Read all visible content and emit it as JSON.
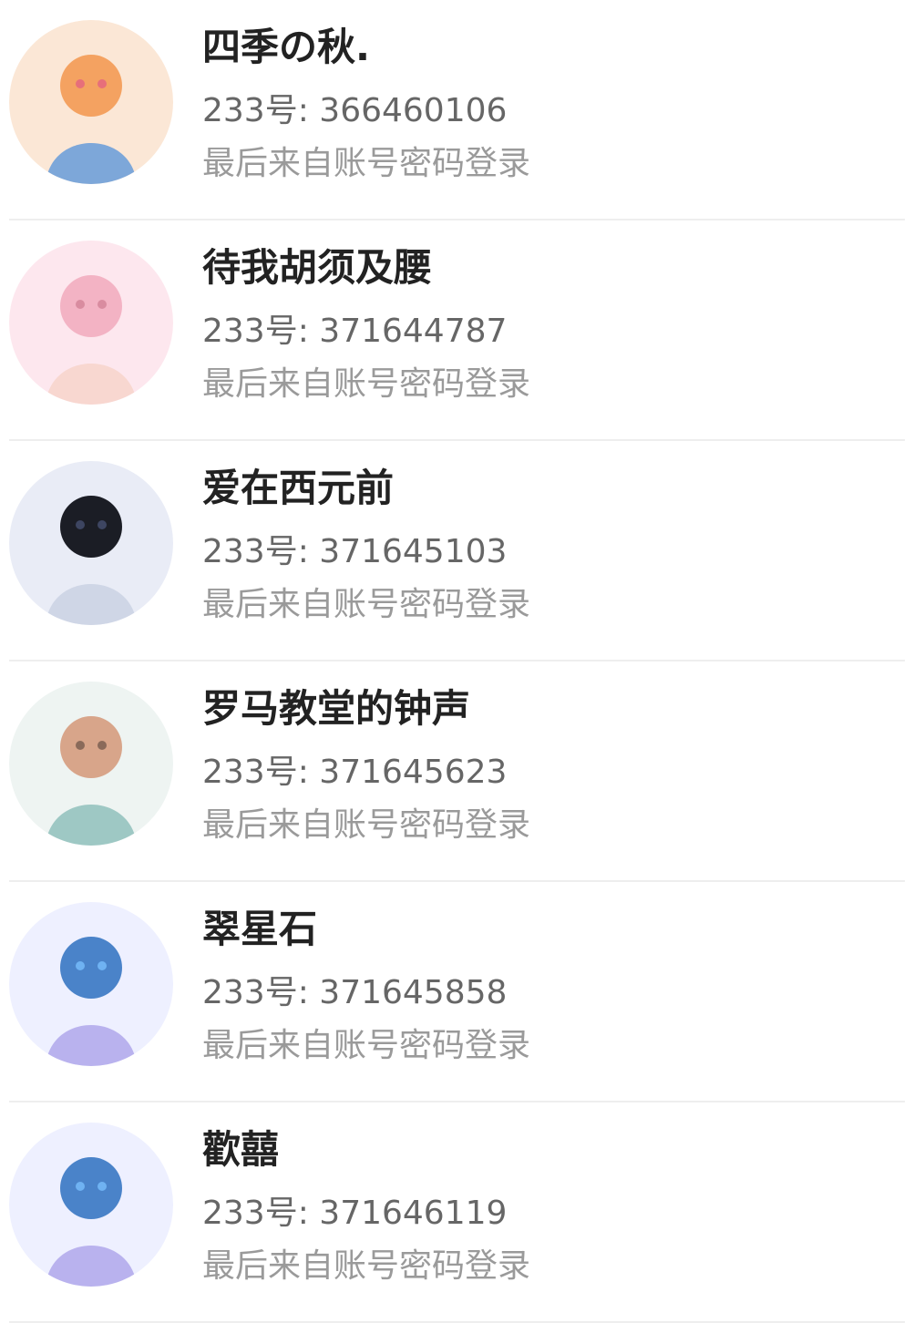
{
  "accounts": [
    {
      "name": "四季の秋.",
      "id_text": "233号: 366460106",
      "login_text": "最后来自账号密码登录",
      "avatar_colors": [
        "#fbe7d6",
        "#f4a261",
        "#7da7d9",
        "#e76f7a"
      ]
    },
    {
      "name": "待我胡须及腰",
      "id_text": "233号: 371644787",
      "login_text": "最后来自账号密码登录",
      "avatar_colors": [
        "#fde7ee",
        "#f3b3c4",
        "#f8d7d0",
        "#d98ca0"
      ]
    },
    {
      "name": "爱在西元前",
      "id_text": "233号: 371645103",
      "login_text": "最后来自账号密码登录",
      "avatar_colors": [
        "#e9ecf6",
        "#1b1d25",
        "#cfd6e6",
        "#3d4561"
      ]
    },
    {
      "name": "罗马教堂的钟声",
      "id_text": "233号: 371645623",
      "login_text": "最后来自账号密码登录",
      "avatar_colors": [
        "#eef4f2",
        "#d8a58a",
        "#9ec8c4",
        "#8a6a5a"
      ]
    },
    {
      "name": "翠星石",
      "id_text": "233号: 371645858",
      "login_text": "最后来自账号密码登录",
      "avatar_colors": [
        "#eef0ff",
        "#4a83c9",
        "#b9b2ee",
        "#6fb2f2"
      ]
    },
    {
      "name": "歡囍",
      "id_text": "233号: 371646119",
      "login_text": "最后来自账号密码登录",
      "avatar_colors": [
        "#eef0ff",
        "#4a83c9",
        "#b9b2ee",
        "#6fb2f2"
      ]
    }
  ]
}
